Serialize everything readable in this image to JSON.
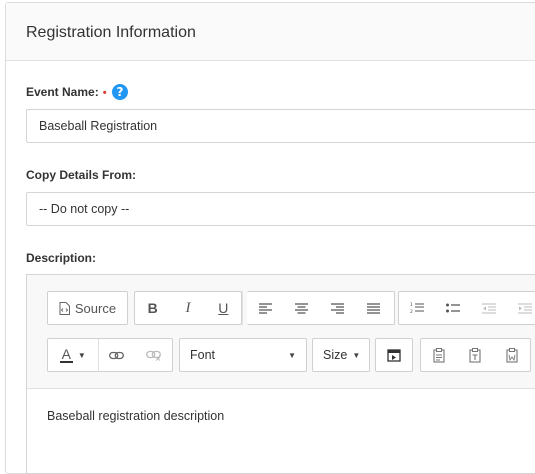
{
  "panel": {
    "title": "Registration Information"
  },
  "event_name": {
    "label": "Event Name:",
    "required_mark": "•",
    "help_glyph": "?",
    "value": "Baseball Registration"
  },
  "copy_details": {
    "label": "Copy Details From:",
    "value": "-- Do not copy --"
  },
  "description": {
    "label": "Description:",
    "content": "Baseball registration description",
    "toolbar": {
      "source_label": "Source",
      "bold": "B",
      "italic": "I",
      "underline": "U",
      "text_color_glyph": "A",
      "font_label": "Font",
      "size_label": "Size"
    }
  }
}
